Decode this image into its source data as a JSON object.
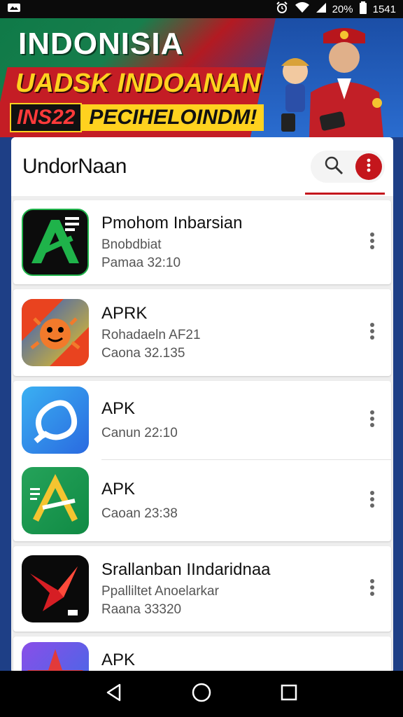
{
  "status_bar": {
    "battery_percent": "20%",
    "time": "1541",
    "icons": [
      "notification-icon",
      "alarm-icon",
      "wifi-icon",
      "signal-icon",
      "battery-icon"
    ]
  },
  "banner": {
    "line1": "INDONISIA",
    "line2": "UADSK INDOANAN",
    "promo_code": "INS22",
    "promo_text": "PECIHELOINDM!"
  },
  "header": {
    "title": "UndorNaan",
    "accent_color": "#c4161c"
  },
  "apps": [
    {
      "name": "Pmohom Inbarsian",
      "subtitle": "Bnobdbiat",
      "meta": "Pamaa 32:10",
      "icon": "green-a-app-icon"
    },
    {
      "name": "APRK",
      "subtitle": "Rohadaeln AF21",
      "meta": "Caona 32.135",
      "icon": "orange-bug-app-icon"
    },
    {
      "name": "APK",
      "subtitle": "",
      "meta": "Canun 22:10",
      "icon": "blue-chat-app-icon"
    },
    {
      "name": "APK",
      "subtitle": "",
      "meta": "Caoan 23:38",
      "icon": "green-gold-a-app-icon"
    },
    {
      "name": "Srallanban IIndaridnaa",
      "subtitle": "Ppalliltet Anoelarkar",
      "meta": "Raana 33320",
      "icon": "red-origami-app-icon"
    },
    {
      "name": "APK",
      "subtitle": "",
      "meta": "",
      "icon": "purple-star-app-icon"
    }
  ],
  "nav": {
    "back": "back-icon",
    "home": "home-icon",
    "recents": "recents-icon"
  }
}
